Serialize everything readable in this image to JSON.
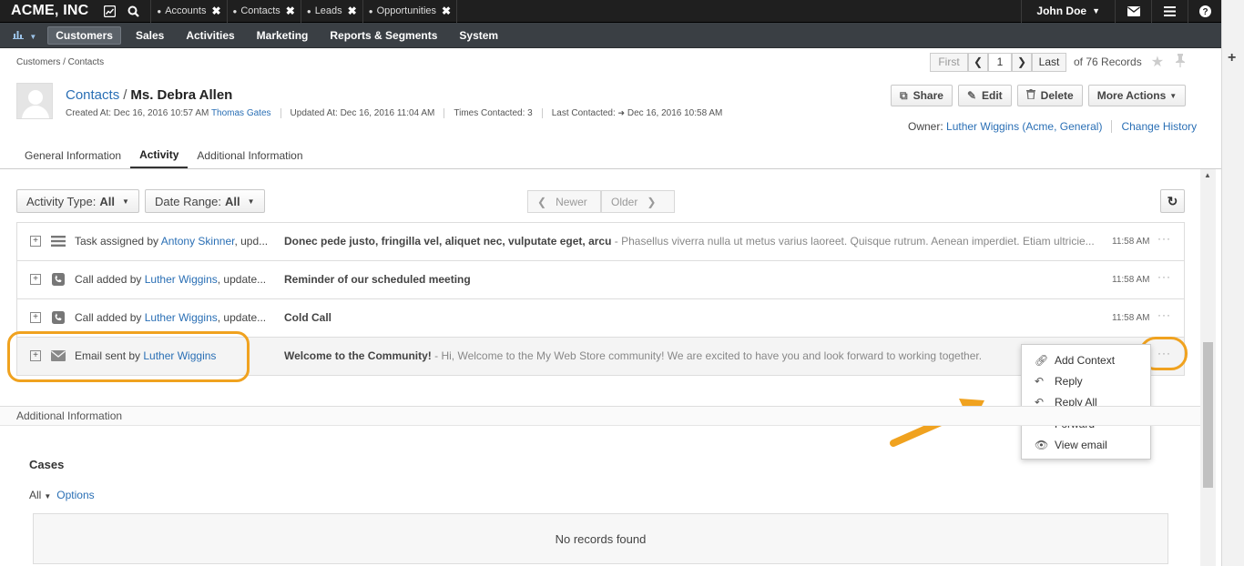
{
  "topbar": {
    "brand": "ACME, INC",
    "tabs": [
      {
        "label": "Accounts"
      },
      {
        "label": "Contacts"
      },
      {
        "label": "Leads"
      },
      {
        "label": "Opportunities"
      }
    ],
    "user": "John Doe"
  },
  "nav": {
    "items": [
      "Customers",
      "Sales",
      "Activities",
      "Marketing",
      "Reports & Segments",
      "System"
    ]
  },
  "breadcrumb": "Customers / Contacts",
  "pager": {
    "first": "First",
    "page": "1",
    "last": "Last",
    "records": "of 76 Records"
  },
  "record": {
    "entity": "Contacts",
    "separator": "/",
    "name": "Ms. Debra Allen",
    "created_label": "Created At: Dec 16, 2016 10:57 AM",
    "created_by": "Thomas Gates",
    "updated": "Updated At: Dec 16, 2016 11:04 AM",
    "times_contacted": "Times Contacted: 3",
    "last_contacted_label": "Last Contacted:",
    "last_contacted": "Dec 16, 2016 10:58 AM",
    "owner_label": "Owner:",
    "owner": "Luther Wiggins",
    "owner_org": "(Acme, General)",
    "change_history": "Change History"
  },
  "actions": {
    "share": "Share",
    "edit": "Edit",
    "delete": "Delete",
    "more": "More Actions"
  },
  "record_tabs": [
    "General Information",
    "Activity",
    "Additional Information"
  ],
  "filters": {
    "activity_type_label": "Activity Type:",
    "activity_type_value": "All",
    "date_range_label": "Date Range:",
    "date_range_value": "All",
    "newer": "Newer",
    "older": "Older"
  },
  "activities": [
    {
      "icon": "task-icon",
      "prefix": "Task assigned by ",
      "user": "Antony Skinner",
      "suffix": ", upd...",
      "subject": "Donec pede justo, fringilla vel, aliquet nec, vulputate eget, arcu",
      "snippet": " - Phasellus viverra nulla ut metus varius laoreet. Quisque rutrum. Aenean imperdiet. Etiam ultricie...",
      "time": "11:58 AM"
    },
    {
      "icon": "phone-icon",
      "prefix": "Call added by ",
      "user": "Luther Wiggins",
      "suffix": ", update...",
      "subject": "Reminder of our scheduled meeting",
      "snippet": "",
      "time": "11:58 AM"
    },
    {
      "icon": "phone-icon",
      "prefix": "Call added by ",
      "user": "Luther Wiggins",
      "suffix": ", update...",
      "subject": "Cold Call",
      "snippet": "",
      "time": "11:58 AM"
    },
    {
      "icon": "envelope-icon",
      "prefix": "Email sent by ",
      "user": "Luther Wiggins",
      "suffix": "",
      "subject": "Welcome to the Community!",
      "snippet": " - Hi, Welcome to the My Web Store community! We are excited to have you and look forward to working together.",
      "time": ""
    }
  ],
  "context_menu": [
    "Add Context",
    "Reply",
    "Reply All",
    "Forward",
    "View email"
  ],
  "additional_info": {
    "header": "Additional Information",
    "cases_title": "Cases",
    "filter_all": "All",
    "options": "Options",
    "no_records": "No records found"
  },
  "colors": {
    "topbar": "#1f1f1f",
    "navbar": "#3a3f44",
    "link": "#2a6fb5",
    "highlight": "#f0a21f"
  }
}
